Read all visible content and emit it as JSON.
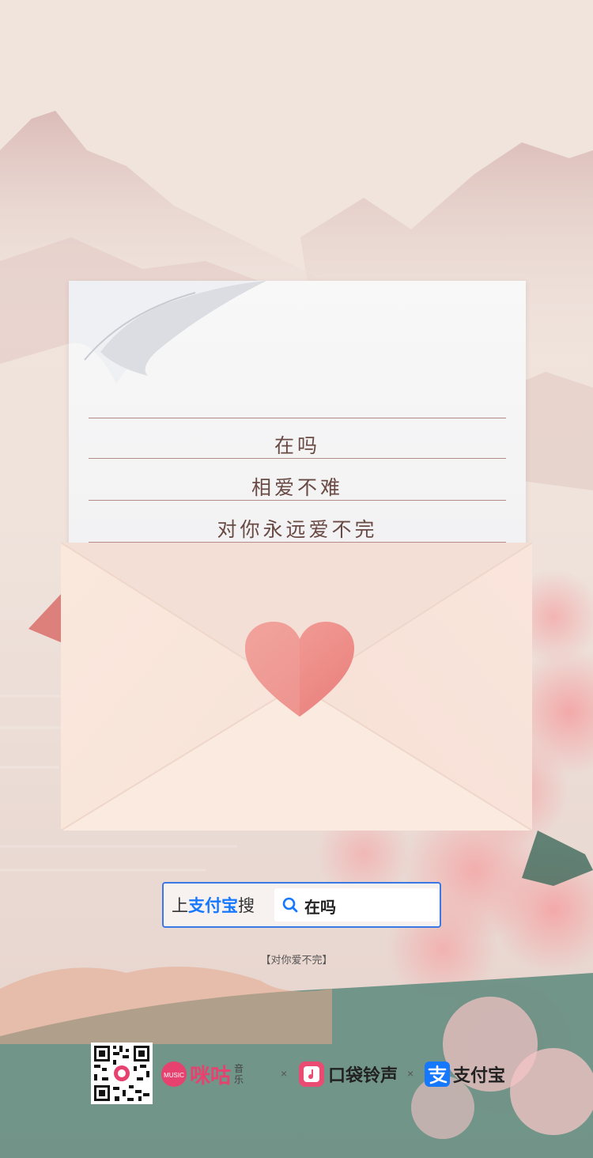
{
  "letter": {
    "lines": [
      "在吗",
      "相爱不难",
      "对你永远爱不完"
    ]
  },
  "search": {
    "prefix_1": "上",
    "brand": "支付宝",
    "prefix_2": "搜",
    "value": "在吗"
  },
  "subtitle": "【对你爱不完】",
  "footer": {
    "migu_name": "咪咕",
    "migu_sub_1": "音",
    "migu_sub_2": "乐",
    "migu_badge": "MUSIC",
    "sep": "×",
    "ringtone_name": "口袋铃声",
    "alipay_name": "支付宝"
  },
  "colors": {
    "accent_blue": "#1677ff",
    "migu_pink": "#e6416f",
    "heart_pink": "#ef8d8a"
  }
}
